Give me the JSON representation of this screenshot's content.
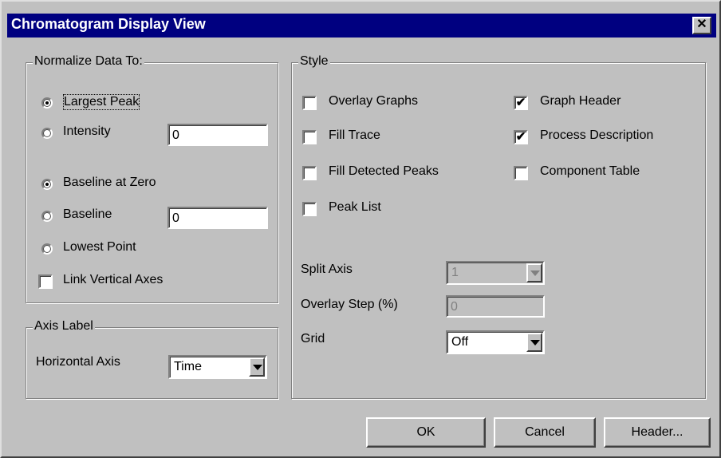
{
  "window": {
    "title": "Chromatogram Display View",
    "close_glyph": "✕"
  },
  "normalize": {
    "legend": "Normalize Data To:",
    "largest_peak": {
      "label": "Largest Peak",
      "selected": true
    },
    "intensity": {
      "label": "Intensity",
      "selected": false,
      "value": "0"
    },
    "baseline_zero": {
      "label": "Baseline at Zero",
      "selected": true
    },
    "baseline": {
      "label": "Baseline",
      "selected": false,
      "value": "0"
    },
    "lowest_point": {
      "label": "Lowest Point",
      "selected": false
    },
    "link_axes": {
      "label": "Link Vertical Axes",
      "checked": false
    }
  },
  "axis_label": {
    "legend": "Axis Label",
    "horizontal_label": "Horizontal Axis",
    "horizontal_value": "Time"
  },
  "style": {
    "legend": "Style",
    "overlay_graphs": {
      "label": "Overlay Graphs",
      "checked": false
    },
    "fill_trace": {
      "label": "Fill Trace",
      "checked": false
    },
    "fill_detected": {
      "label": "Fill Detected Peaks",
      "checked": false
    },
    "peak_list": {
      "label": "Peak List",
      "checked": false
    },
    "graph_header": {
      "label": "Graph Header",
      "checked": true
    },
    "process_desc": {
      "label": "Process Description",
      "checked": true
    },
    "component_table": {
      "label": "Component Table",
      "checked": false
    },
    "split_axis": {
      "label": "Split Axis",
      "value": "1"
    },
    "overlay_step": {
      "label": "Overlay Step (%)",
      "value": "0"
    },
    "grid": {
      "label": "Grid",
      "value": "Off"
    }
  },
  "buttons": {
    "ok": "OK",
    "cancel": "Cancel",
    "header": "Header..."
  },
  "check_glyph": "✔"
}
